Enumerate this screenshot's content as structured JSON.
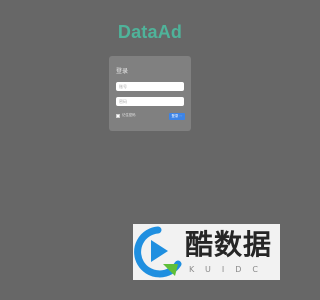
{
  "brand": {
    "name": "DataAd"
  },
  "login_panel": {
    "title": "登录",
    "username_placeholder": "账号",
    "password_placeholder": "密码",
    "remember_label": "记住密码",
    "submit_label": "登录 ☞"
  },
  "watermark": {
    "text": "酷数据",
    "subtext": "KUIDC",
    "logo_colors": {
      "blue": "#1f8fe0",
      "green": "#5fbf3a"
    }
  },
  "colors": {
    "background": "#676767",
    "panel": "#808080",
    "brand": "#4fb39a",
    "button": "#3d84e6"
  }
}
